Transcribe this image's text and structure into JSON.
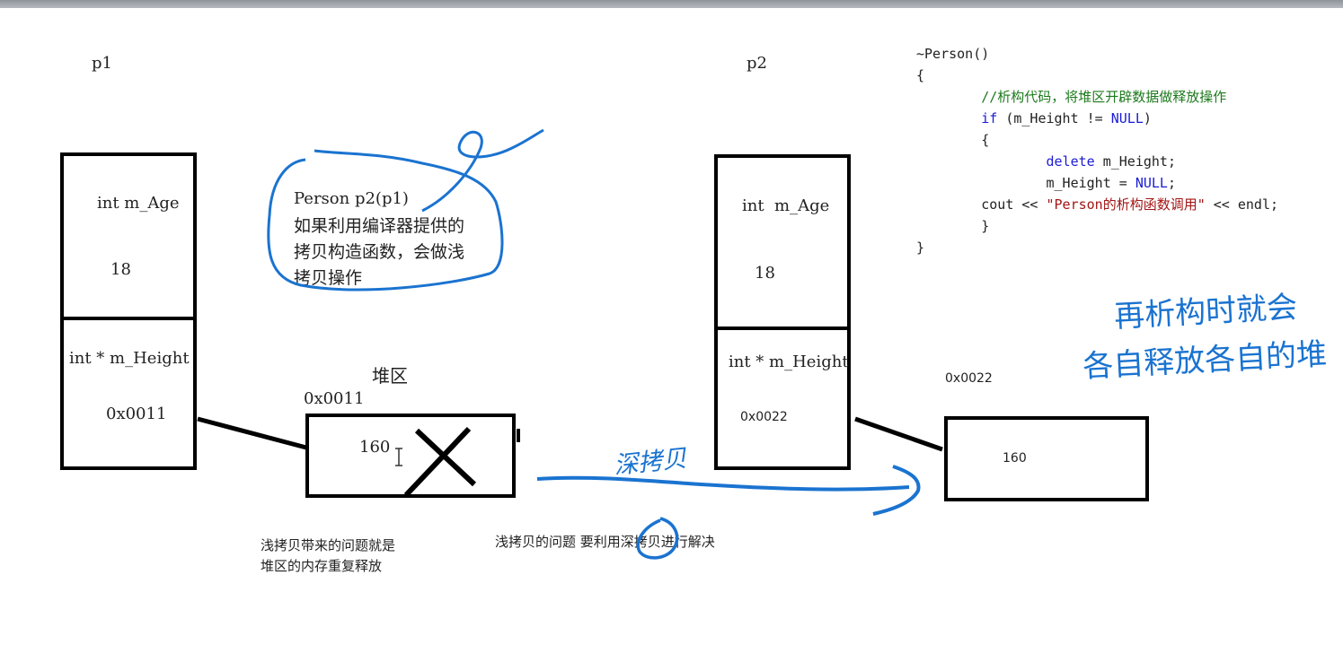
{
  "labels": {
    "p1": "p1",
    "p2": "p2",
    "heap_title": "堆区",
    "heap_addr_left": "0x0011",
    "heap_addr_right": "0x0022"
  },
  "p1_box": {
    "age_field": "int m_Age",
    "age_value": "18",
    "height_field": "int * m_Height",
    "height_value": "0x0011"
  },
  "p2_box": {
    "age_field": "int  m_Age",
    "age_value": "18",
    "height_field": "int * m_Height",
    "height_value": "0x0022"
  },
  "heap_left_value": "160",
  "heap_right_value": "160",
  "bubble": {
    "line1": "Person p2(p1)",
    "line2": "如果利用编译器提供的",
    "line3": "拷贝构造函数，会做浅",
    "line4": "拷贝操作"
  },
  "notes": {
    "shallow_problem_1": "浅拷贝带来的问题就是",
    "shallow_problem_2": "堆区的内存重复释放",
    "solution": "浅拷贝的问题 要利用深拷贝进行解决"
  },
  "handwriting": {
    "deep_copy": "深拷贝",
    "right_note_1": "再析构时就会",
    "right_note_2": "各自释放各自的堆"
  },
  "code": {
    "l1": "~Person()",
    "l2": "{",
    "l3": "        //析构代码，将堆区开辟数据做释放操作",
    "l4_kw": "        if",
    "l4_rest": " (m_Height != ",
    "l4_null": "NULL",
    "l4_end": ")",
    "l5": "        {",
    "l6_kw": "                delete",
    "l6_rest": " m_Height;",
    "l7_pre": "                m_Height = ",
    "l7_null": "NULL",
    "l7_end": ";",
    "l8_pre": "        cout << ",
    "l8_str": "\"Person的析构函数调用\"",
    "l8_end": " << endl;",
    "l9": "        }",
    "l10": "}"
  },
  "colors": {
    "keyword": "#1b1bd6",
    "comment": "#1c7a1c",
    "string": "#a31515",
    "ink_blue": "#1a73d0"
  }
}
